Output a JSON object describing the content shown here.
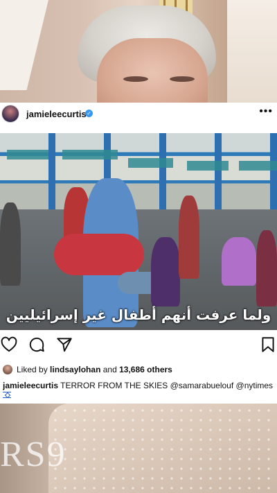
{
  "post": {
    "username": "jamieleecurtis",
    "verified_icon": "verified-badge-icon",
    "more_icon": "more-options-icon",
    "more_label": "•••",
    "image_caption_arabic": "ولما عرفت أنهم أطفال غير إسرائيليين",
    "actions": {
      "like_icon": "heart-icon",
      "comment_icon": "comment-icon",
      "share_icon": "share-icon",
      "save_icon": "bookmark-icon"
    },
    "likes": {
      "prefix": "Liked by ",
      "liked_by_user": "lindsaylohan",
      "middle": " and ",
      "others_count": "13,686 others"
    },
    "caption": {
      "username": "jamieleecurtis",
      "text": " TERROR FROM THE SKIES @samarabuelouf @nytimes"
    },
    "flag_icon": "israel-flag-icon"
  },
  "background": {
    "bottom_text": "RS9"
  },
  "colors": {
    "verified": "#3897f0",
    "card_bg": "#ffffff",
    "text": "#111111"
  }
}
